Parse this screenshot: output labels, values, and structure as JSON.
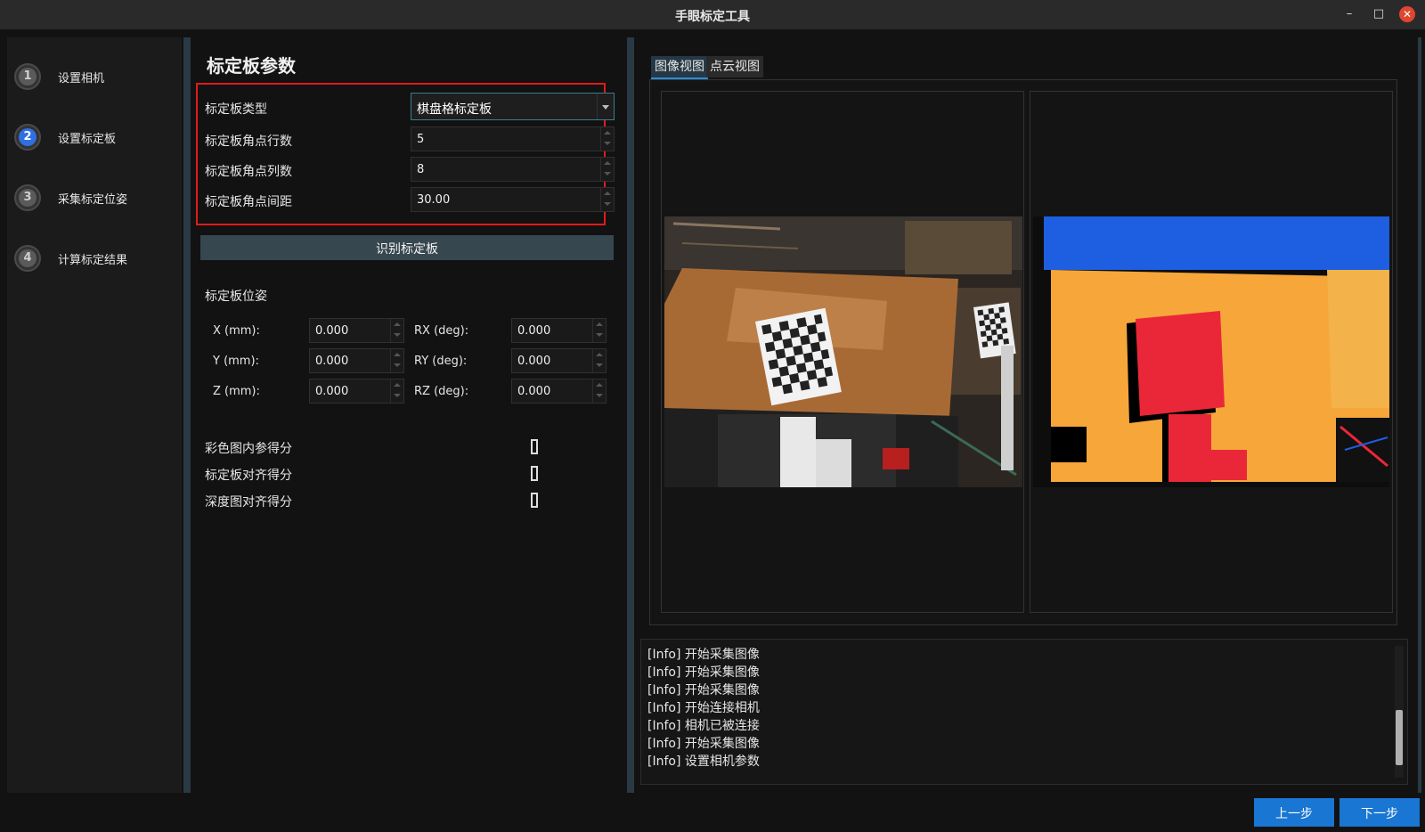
{
  "window": {
    "title": "手眼标定工具",
    "minimize": "–",
    "maximize": "□",
    "close": "✕"
  },
  "sidebar": {
    "steps": [
      {
        "num": "1",
        "label": "设置相机"
      },
      {
        "num": "2",
        "label": "设置标定板"
      },
      {
        "num": "3",
        "label": "采集标定位姿"
      },
      {
        "num": "4",
        "label": "计算标定结果"
      }
    ],
    "active_step": 2
  },
  "board": {
    "section_title": "标定板参数",
    "type_label": "标定板类型",
    "type_value": "棋盘格标定板",
    "rows_label": "标定板角点行数",
    "rows_value": "5",
    "cols_label": "标定板角点列数",
    "cols_value": "8",
    "spacing_label": "标定板角点间距",
    "spacing_value": "30.00",
    "detect_button": "识别标定板"
  },
  "pose": {
    "title": "标定板位姿",
    "x_label": "X (mm):",
    "x_value": "0.000",
    "y_label": "Y (mm):",
    "y_value": "0.000",
    "z_label": "Z (mm):",
    "z_value": "0.000",
    "rx_label": "RX (deg):",
    "rx_value": "0.000",
    "ry_label": "RY (deg):",
    "ry_value": "0.000",
    "rz_label": "RZ (deg):",
    "rz_value": "0.000"
  },
  "scores": {
    "color_intrinsic_label": "彩色图内参得分",
    "board_align_label": "标定板对齐得分",
    "depth_align_label": "深度图对齐得分"
  },
  "views": {
    "tab_image": "图像视图",
    "tab_cloud": "点云视图",
    "active_tab": "图像视图"
  },
  "log": {
    "lines": [
      "[Info] 开始采集图像",
      "[Info] 开始采集图像",
      "[Info] 开始采集图像",
      "[Info] 开始连接相机",
      "[Info] 相机已被连接",
      "[Info] 开始采集图像",
      "[Info] 设置相机参数"
    ]
  },
  "nav": {
    "prev": "上一步",
    "next": "下一步"
  },
  "colors": {
    "accent": "#1976d2",
    "highlight": "#e11b1b",
    "active_step": "#2f6fe0"
  }
}
